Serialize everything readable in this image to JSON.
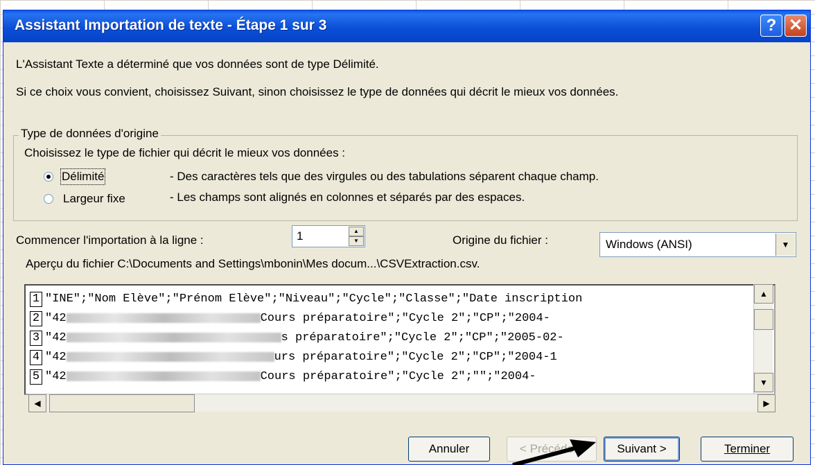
{
  "window": {
    "title": "Assistant Importation de texte - Étape 1 sur 3",
    "help_label": "?",
    "close_label": "✕"
  },
  "intro": {
    "line1": "L'Assistant Texte a déterminé que vos données sont de type Délimité.",
    "line2": "Si ce choix vous convient, choisissez Suivant, sinon choisissez le type de données qui décrit le mieux vos données."
  },
  "data_type_group": {
    "legend": "Type de données d'origine",
    "prompt": "Choisissez le type de fichier qui décrit le mieux vos données :",
    "options": [
      {
        "label": "Délimité",
        "description": "- Des caractères tels que des virgules ou des tabulations séparent chaque champ.",
        "selected": true
      },
      {
        "label": "Largeur fixe",
        "description": "- Les champs sont alignés en colonnes et séparés par des espaces.",
        "selected": false
      }
    ]
  },
  "start_row": {
    "label": "Commencer l'importation à la ligne :",
    "value": "1"
  },
  "file_origin": {
    "label": "Origine du fichier :",
    "value": "Windows (ANSI)"
  },
  "preview": {
    "label": "Aperçu du fichier C:\\Documents and Settings\\mbonin\\Mes docum...\\CSVExtraction.csv.",
    "lines": [
      {
        "number": "1",
        "start": "\"INE\";\"Nom Elève\";\"Prénom Elève\";\"Niveau\";\"Cycle\";\"Classe\";\"Date inscription",
        "end": ""
      },
      {
        "number": "2",
        "start": "\"42",
        "end": "Cours préparatoire\";\"Cycle 2\";\"CP\";\"2004-"
      },
      {
        "number": "3",
        "start": "\"42",
        "end": "s préparatoire\";\"Cycle 2\";\"CP\";\"2005-02-"
      },
      {
        "number": "4",
        "start": "\"42",
        "end": "urs préparatoire\";\"Cycle 2\";\"CP\";\"2004-1"
      },
      {
        "number": "5",
        "start": "\"42",
        "end": "Cours préparatoire\";\"Cycle 2\";\"\";\"2004-"
      }
    ]
  },
  "buttons": {
    "cancel": "Annuler",
    "previous": "< Précédent",
    "next": "Suivant >",
    "finish": "Terminer"
  },
  "colors": {
    "titlebar": "#0a5ce8",
    "dialog_bg": "#ece9d8"
  }
}
